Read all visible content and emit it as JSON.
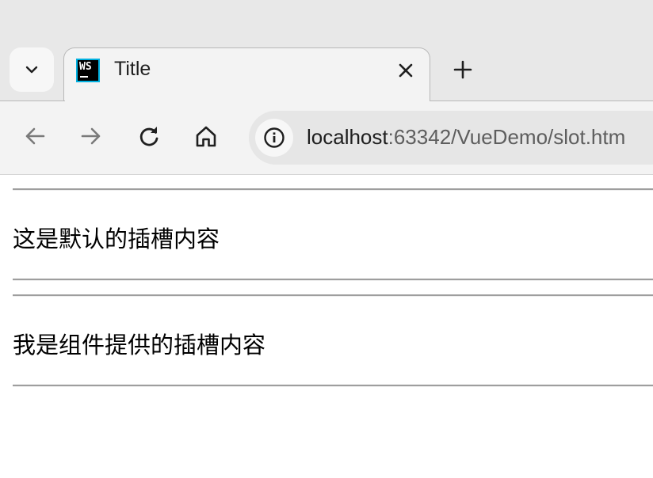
{
  "browser": {
    "tab": {
      "title": "Title",
      "favicon_text": "WS"
    },
    "url": {
      "host": "localhost",
      "rest": ":63342/VueDemo/slot.htm"
    },
    "icons": {
      "tab_list": "chevron-down-icon",
      "close": "close-icon",
      "new_tab": "plus-icon",
      "back": "arrow-left-icon",
      "forward": "arrow-right-icon",
      "reload": "reload-icon",
      "home": "home-icon",
      "site_info": "info-icon"
    }
  },
  "page": {
    "paragraphs": [
      "这是默认的插槽内容",
      "我是组件提供的插槽内容"
    ]
  }
}
